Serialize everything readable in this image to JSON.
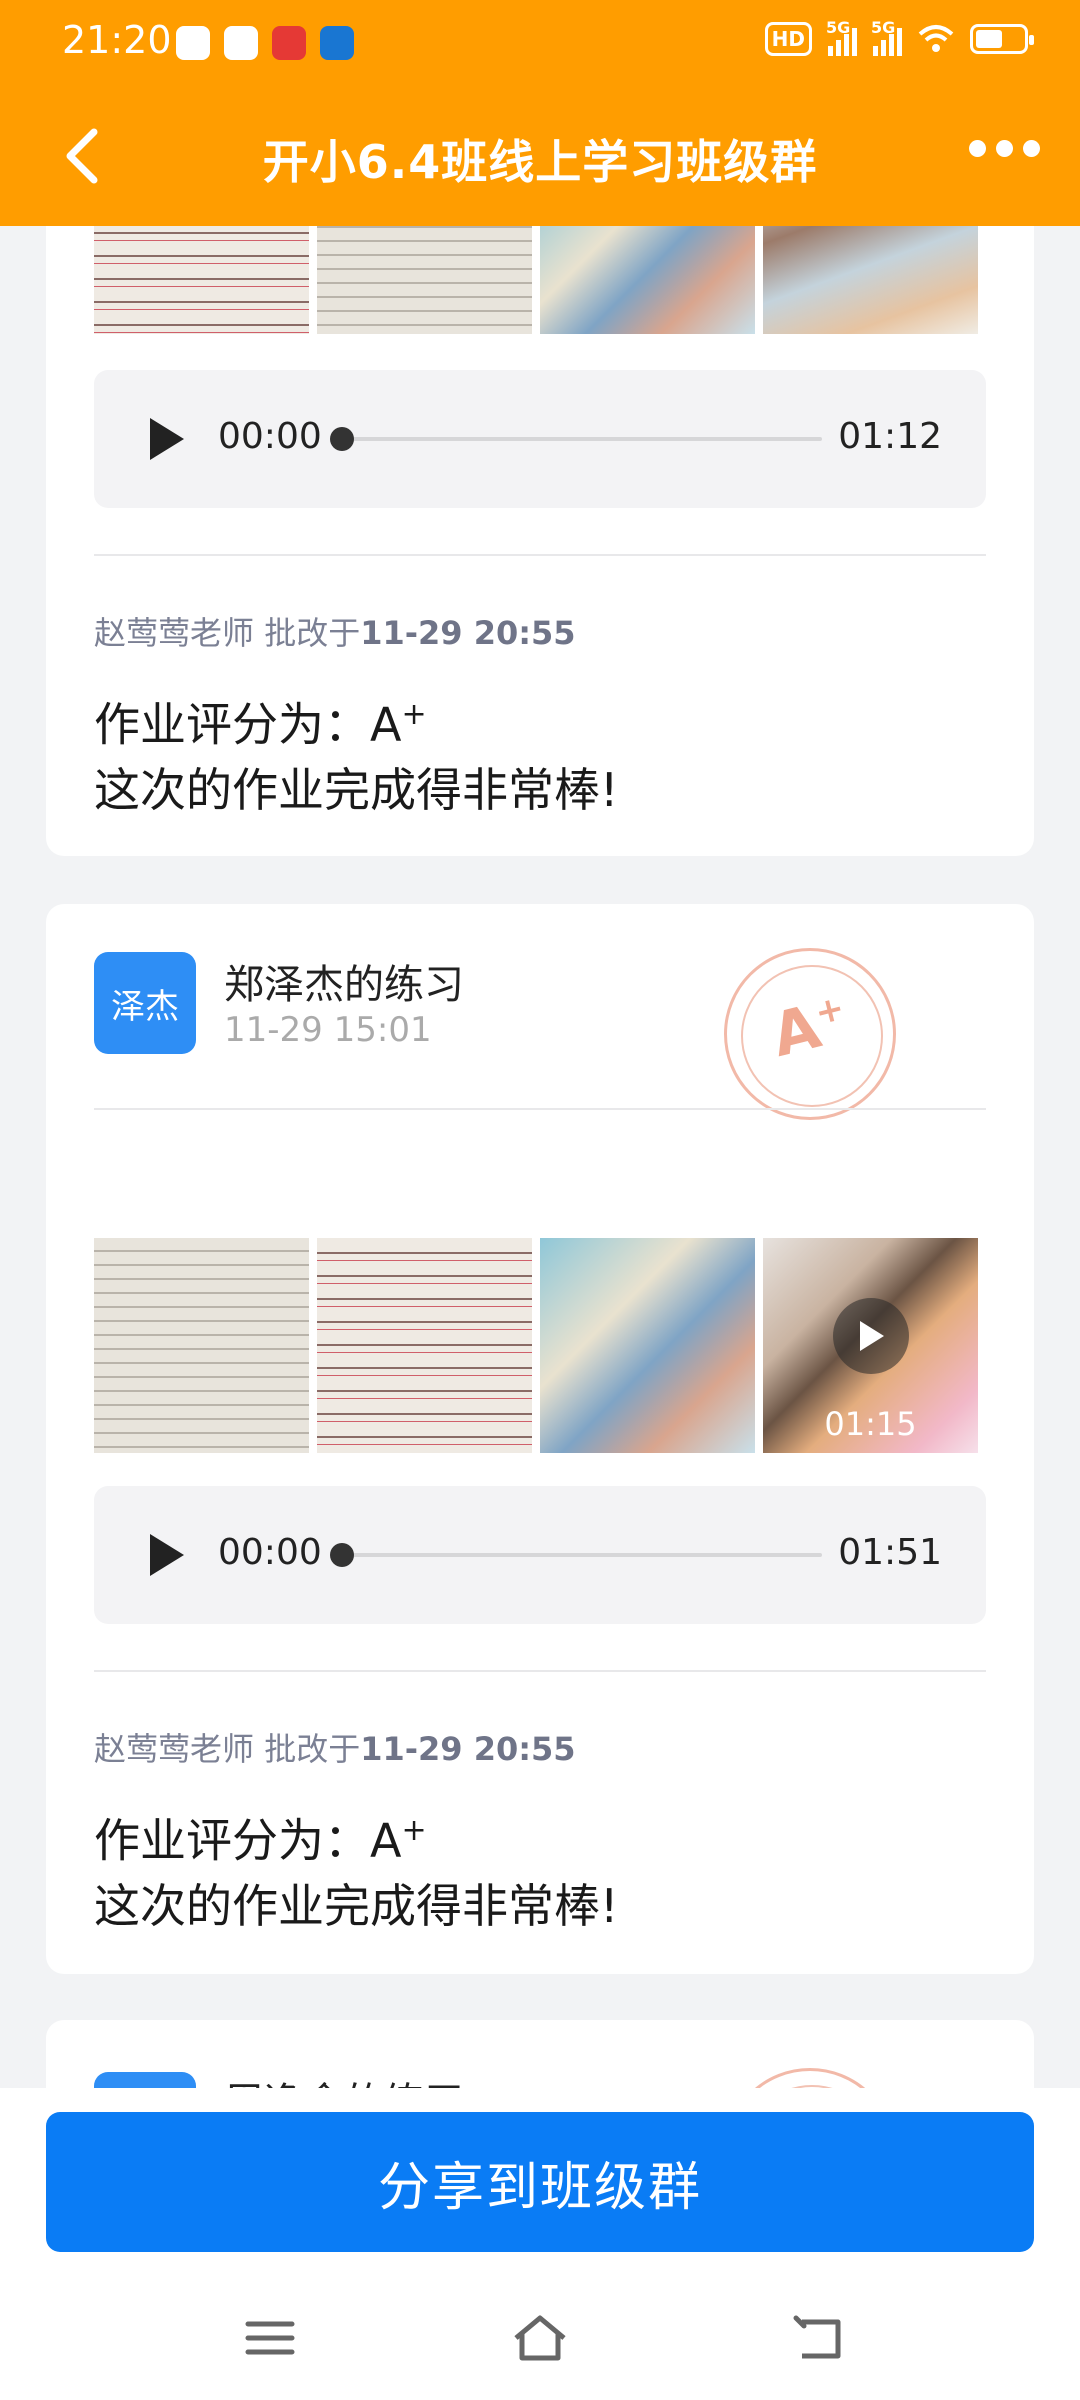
{
  "status_bar": {
    "time": "21:20",
    "hd_label": "HD",
    "sim1_label": "5G",
    "sim2_label": "5G"
  },
  "header": {
    "title": "开小6.4班线上学习班级群"
  },
  "card1": {
    "audio": {
      "current": "00:00",
      "duration": "01:12",
      "progress": 0
    },
    "review": {
      "teacher": "赵莺莺老师",
      "action": "批改于",
      "time": "11-29 20:55"
    },
    "grade_prefix": "作业评分为：",
    "grade_value": "A",
    "grade_plus": "+",
    "comment": "这次的作业完成得非常棒!"
  },
  "card2": {
    "avatar_text": "泽杰",
    "name": "郑泽杰的练习",
    "date": "11-29 15:01",
    "stamp_grade": "A",
    "stamp_plus": "+",
    "video_duration": "01:15",
    "audio": {
      "current": "00:00",
      "duration": "01:51",
      "progress": 0
    },
    "review": {
      "teacher": "赵莺莺老师",
      "action": "批改于",
      "time": "11-29 20:55"
    },
    "grade_prefix": "作业评分为：",
    "grade_value": "A",
    "grade_plus": "+",
    "comment": "这次的作业完成得非常棒!"
  },
  "card3": {
    "name": "周逸余的练习"
  },
  "bottom": {
    "share_label": "分享到班级群"
  },
  "icons": [
    "back-icon",
    "more-icon",
    "play-icon",
    "video-play-icon",
    "menu-icon",
    "home-icon",
    "return-icon"
  ],
  "colors": {
    "header": "#ff9d00",
    "primary_button": "#0a7cf5",
    "avatar": "#2e8ef5",
    "stamp": "#f0a890"
  }
}
